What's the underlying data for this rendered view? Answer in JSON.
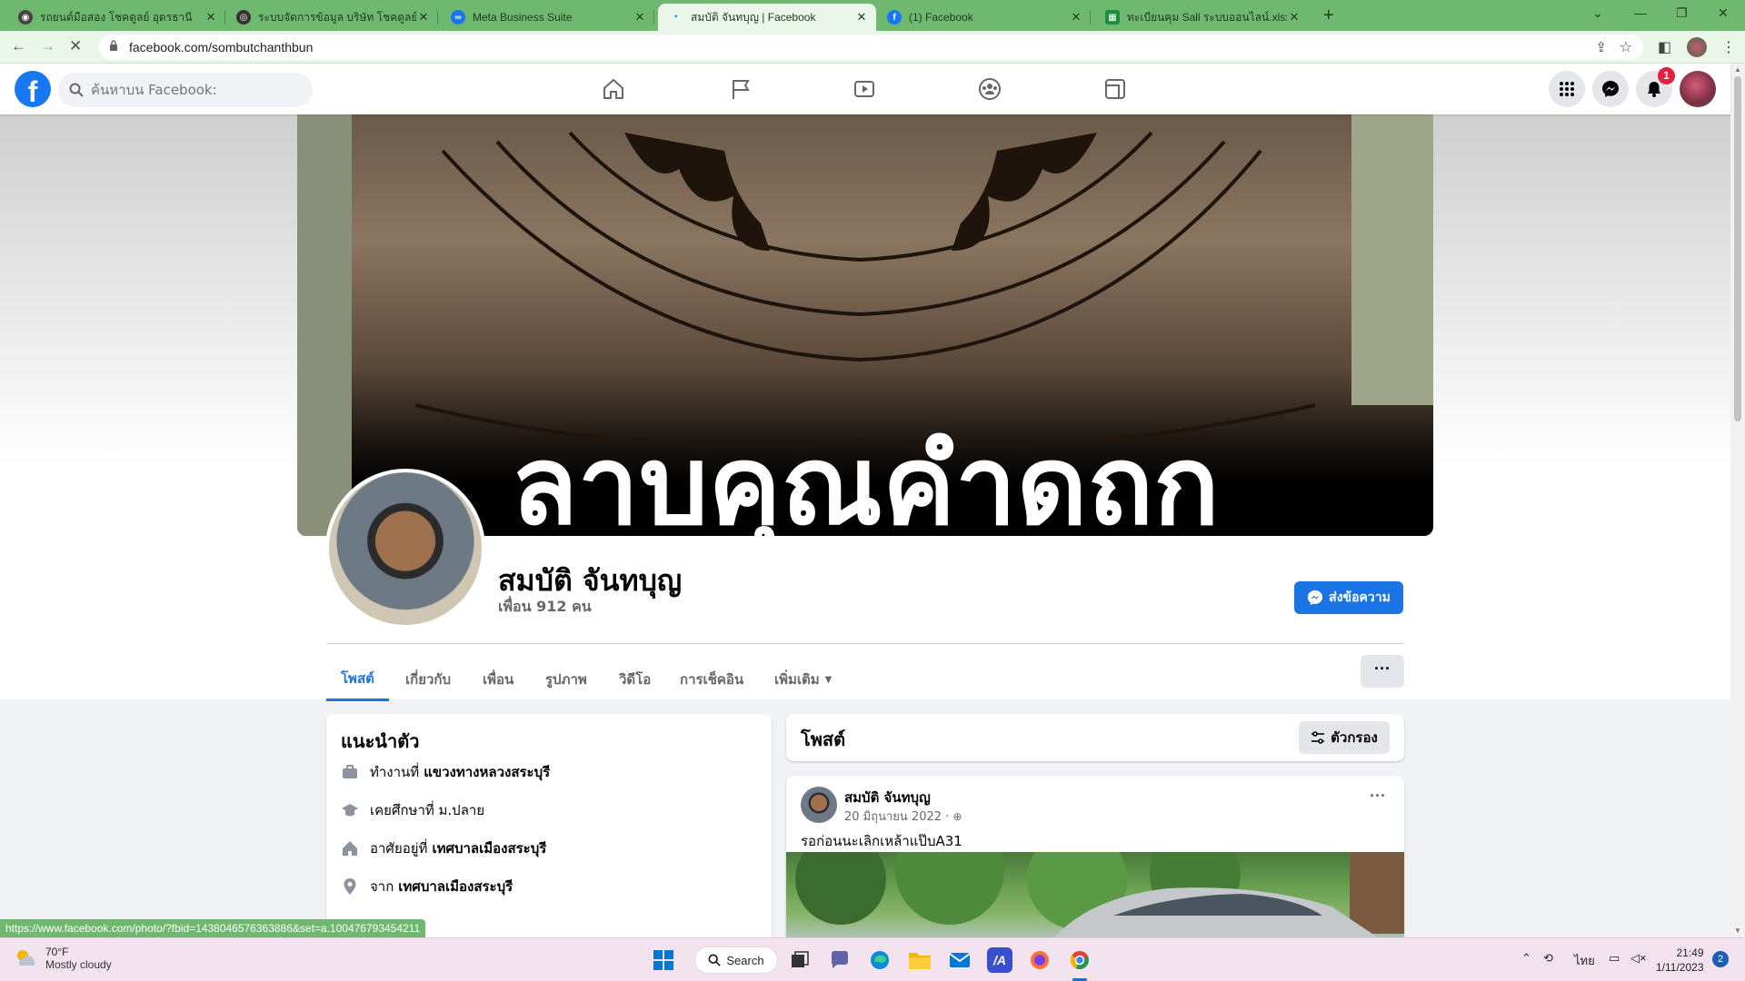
{
  "browser": {
    "tabs": [
      {
        "label": "รถยนต์มือสอง โชคดูลย์ อุดรธานี",
        "fav_color": "#444444",
        "fav_glyph": "◉"
      },
      {
        "label": "ระบบจัดการข้อมูล บริษัท โชคดูลย์",
        "fav_color": "#333333",
        "fav_glyph": "◎"
      },
      {
        "label": "Meta Business Suite",
        "fav_color": "#1877f2",
        "fav_glyph": "∞"
      },
      {
        "label": "สมบัติ จันทบุญ | Facebook",
        "fav_color": "#1877f2",
        "fav_glyph": "·"
      },
      {
        "label": "(1) Facebook",
        "fav_color": "#1877f2",
        "fav_glyph": "f"
      },
      {
        "label": "ทะเบียนคุม Sall ระบบออนไลน์.xlsx - G",
        "fav_color": "#1e8e3e",
        "fav_glyph": "▦"
      }
    ],
    "url": "facebook.com/sombutchanthbun"
  },
  "fb": {
    "search_placeholder": "ค้นหาบน Facebook:",
    "notification_count": "1"
  },
  "profile": {
    "cover_text": "ลาบคุณคำดถก",
    "name": "สมบัติ จันทบุญ",
    "friends": "เพื่อน 912 คน",
    "message_button": "ส่งข้อความ",
    "tabs": [
      "โพสต์",
      "เกี่ยวกับ",
      "เพื่อน",
      "รูปภาพ",
      "วิดีโอ",
      "การเช็คอิน",
      "เพิ่มเติม"
    ],
    "more_button": "···"
  },
  "intro": {
    "title": "แนะนำตัว",
    "rows": [
      {
        "prefix": "ทำงานที่",
        "value": "แขวงทางหลวงสระบุรี"
      },
      {
        "prefix": "เคยศึกษาที่ ม.ปลาย",
        "value": ""
      },
      {
        "prefix": "อาศัยอยู่ที่",
        "value": "เทศบาลเมืองสระบุรี"
      },
      {
        "prefix": "จาก",
        "value": "เทศบาลเมืองสระบุรี"
      }
    ]
  },
  "posts": {
    "title": "โพสต์",
    "filter_label": "ตัวกรอง",
    "post": {
      "author": "สมบัติ จันทบุญ",
      "date": "20 มิถุนายน 2022 ·",
      "text": "รอก่อนนะเลิกเหล้าแป๊บA31",
      "menu": "···"
    }
  },
  "statusbar": {
    "url": "https://www.facebook.com/photo/?fbid=1438046576363886&set=a.100476793454211"
  },
  "taskbar": {
    "temperature": "70°F",
    "weather": "Mostly cloudy",
    "search_label": "Search",
    "lang": "ไทย",
    "time": "21:49",
    "date": "1/11/2023",
    "notif_count": "2"
  },
  "colors": {
    "fb_blue": "#1877f2",
    "tab_strip": "#6fb86f",
    "badge_red": "#e41e3f"
  }
}
